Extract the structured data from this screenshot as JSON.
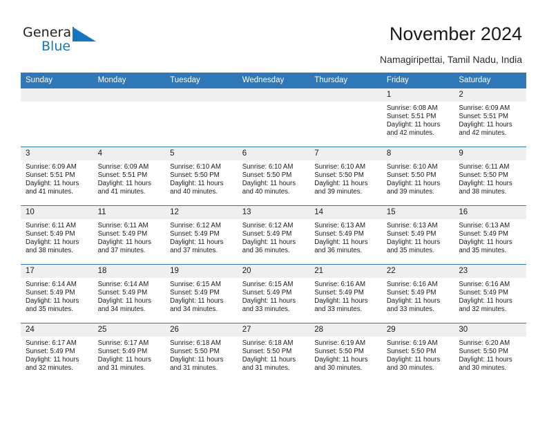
{
  "brand": {
    "name_part1": "General",
    "name_part2": "Blue",
    "mark": "triangle-sail-icon",
    "color_dark": "#231f20",
    "color_blue": "#1277c0"
  },
  "header": {
    "title": "November 2024",
    "subtitle": "Namagiripettai, Tamil Nadu, India"
  },
  "theme": {
    "header_bg": "#3077b8",
    "daynum_bg": "#efefef",
    "cell_bg": "#ffffff",
    "row_border": "#3077b8"
  },
  "weekdays": [
    "Sunday",
    "Monday",
    "Tuesday",
    "Wednesday",
    "Thursday",
    "Friday",
    "Saturday"
  ],
  "weeks": [
    [
      {
        "day": "",
        "empty": true
      },
      {
        "day": "",
        "empty": true
      },
      {
        "day": "",
        "empty": true
      },
      {
        "day": "",
        "empty": true
      },
      {
        "day": "",
        "empty": true
      },
      {
        "day": "1",
        "sunrise": "Sunrise: 6:08 AM",
        "sunset": "Sunset: 5:51 PM",
        "daylight": "Daylight: 11 hours and 42 minutes."
      },
      {
        "day": "2",
        "sunrise": "Sunrise: 6:09 AM",
        "sunset": "Sunset: 5:51 PM",
        "daylight": "Daylight: 11 hours and 42 minutes."
      }
    ],
    [
      {
        "day": "3",
        "sunrise": "Sunrise: 6:09 AM",
        "sunset": "Sunset: 5:51 PM",
        "daylight": "Daylight: 11 hours and 41 minutes."
      },
      {
        "day": "4",
        "sunrise": "Sunrise: 6:09 AM",
        "sunset": "Sunset: 5:51 PM",
        "daylight": "Daylight: 11 hours and 41 minutes."
      },
      {
        "day": "5",
        "sunrise": "Sunrise: 6:10 AM",
        "sunset": "Sunset: 5:50 PM",
        "daylight": "Daylight: 11 hours and 40 minutes."
      },
      {
        "day": "6",
        "sunrise": "Sunrise: 6:10 AM",
        "sunset": "Sunset: 5:50 PM",
        "daylight": "Daylight: 11 hours and 40 minutes."
      },
      {
        "day": "7",
        "sunrise": "Sunrise: 6:10 AM",
        "sunset": "Sunset: 5:50 PM",
        "daylight": "Daylight: 11 hours and 39 minutes."
      },
      {
        "day": "8",
        "sunrise": "Sunrise: 6:10 AM",
        "sunset": "Sunset: 5:50 PM",
        "daylight": "Daylight: 11 hours and 39 minutes."
      },
      {
        "day": "9",
        "sunrise": "Sunrise: 6:11 AM",
        "sunset": "Sunset: 5:50 PM",
        "daylight": "Daylight: 11 hours and 38 minutes."
      }
    ],
    [
      {
        "day": "10",
        "sunrise": "Sunrise: 6:11 AM",
        "sunset": "Sunset: 5:49 PM",
        "daylight": "Daylight: 11 hours and 38 minutes."
      },
      {
        "day": "11",
        "sunrise": "Sunrise: 6:11 AM",
        "sunset": "Sunset: 5:49 PM",
        "daylight": "Daylight: 11 hours and 37 minutes."
      },
      {
        "day": "12",
        "sunrise": "Sunrise: 6:12 AM",
        "sunset": "Sunset: 5:49 PM",
        "daylight": "Daylight: 11 hours and 37 minutes."
      },
      {
        "day": "13",
        "sunrise": "Sunrise: 6:12 AM",
        "sunset": "Sunset: 5:49 PM",
        "daylight": "Daylight: 11 hours and 36 minutes."
      },
      {
        "day": "14",
        "sunrise": "Sunrise: 6:13 AM",
        "sunset": "Sunset: 5:49 PM",
        "daylight": "Daylight: 11 hours and 36 minutes."
      },
      {
        "day": "15",
        "sunrise": "Sunrise: 6:13 AM",
        "sunset": "Sunset: 5:49 PM",
        "daylight": "Daylight: 11 hours and 35 minutes."
      },
      {
        "day": "16",
        "sunrise": "Sunrise: 6:13 AM",
        "sunset": "Sunset: 5:49 PM",
        "daylight": "Daylight: 11 hours and 35 minutes."
      }
    ],
    [
      {
        "day": "17",
        "sunrise": "Sunrise: 6:14 AM",
        "sunset": "Sunset: 5:49 PM",
        "daylight": "Daylight: 11 hours and 35 minutes."
      },
      {
        "day": "18",
        "sunrise": "Sunrise: 6:14 AM",
        "sunset": "Sunset: 5:49 PM",
        "daylight": "Daylight: 11 hours and 34 minutes."
      },
      {
        "day": "19",
        "sunrise": "Sunrise: 6:15 AM",
        "sunset": "Sunset: 5:49 PM",
        "daylight": "Daylight: 11 hours and 34 minutes."
      },
      {
        "day": "20",
        "sunrise": "Sunrise: 6:15 AM",
        "sunset": "Sunset: 5:49 PM",
        "daylight": "Daylight: 11 hours and 33 minutes."
      },
      {
        "day": "21",
        "sunrise": "Sunrise: 6:16 AM",
        "sunset": "Sunset: 5:49 PM",
        "daylight": "Daylight: 11 hours and 33 minutes."
      },
      {
        "day": "22",
        "sunrise": "Sunrise: 6:16 AM",
        "sunset": "Sunset: 5:49 PM",
        "daylight": "Daylight: 11 hours and 33 minutes."
      },
      {
        "day": "23",
        "sunrise": "Sunrise: 6:16 AM",
        "sunset": "Sunset: 5:49 PM",
        "daylight": "Daylight: 11 hours and 32 minutes."
      }
    ],
    [
      {
        "day": "24",
        "sunrise": "Sunrise: 6:17 AM",
        "sunset": "Sunset: 5:49 PM",
        "daylight": "Daylight: 11 hours and 32 minutes."
      },
      {
        "day": "25",
        "sunrise": "Sunrise: 6:17 AM",
        "sunset": "Sunset: 5:49 PM",
        "daylight": "Daylight: 11 hours and 31 minutes."
      },
      {
        "day": "26",
        "sunrise": "Sunrise: 6:18 AM",
        "sunset": "Sunset: 5:50 PM",
        "daylight": "Daylight: 11 hours and 31 minutes."
      },
      {
        "day": "27",
        "sunrise": "Sunrise: 6:18 AM",
        "sunset": "Sunset: 5:50 PM",
        "daylight": "Daylight: 11 hours and 31 minutes."
      },
      {
        "day": "28",
        "sunrise": "Sunrise: 6:19 AM",
        "sunset": "Sunset: 5:50 PM",
        "daylight": "Daylight: 11 hours and 30 minutes."
      },
      {
        "day": "29",
        "sunrise": "Sunrise: 6:19 AM",
        "sunset": "Sunset: 5:50 PM",
        "daylight": "Daylight: 11 hours and 30 minutes."
      },
      {
        "day": "30",
        "sunrise": "Sunrise: 6:20 AM",
        "sunset": "Sunset: 5:50 PM",
        "daylight": "Daylight: 11 hours and 30 minutes."
      }
    ]
  ]
}
